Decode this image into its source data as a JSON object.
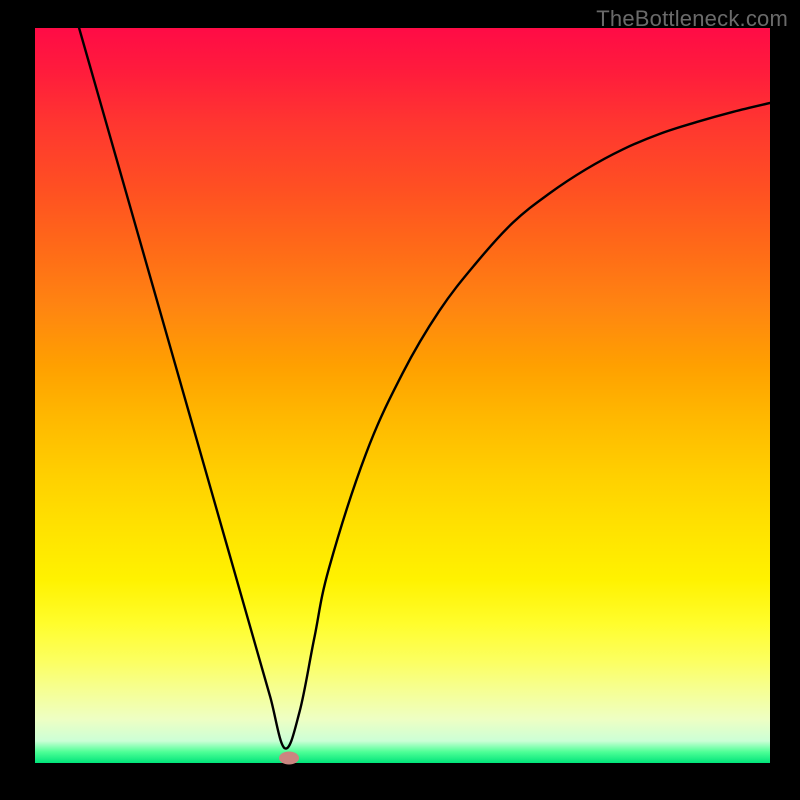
{
  "watermark": "TheBottleneck.com",
  "chart_data": {
    "type": "line",
    "title": "",
    "xlabel": "",
    "ylabel": "",
    "xlim": [
      0,
      100
    ],
    "ylim": [
      0,
      100
    ],
    "series": [
      {
        "name": "curve",
        "x": [
          6,
          8,
          10,
          12,
          14,
          16,
          18,
          20,
          22,
          24,
          26,
          28,
          30,
          32,
          34,
          36,
          38,
          40,
          45,
          50,
          55,
          60,
          65,
          70,
          75,
          80,
          85,
          90,
          95,
          100
        ],
        "y": [
          100,
          93.0,
          86.0,
          79.0,
          72.0,
          65.0,
          58.0,
          51.0,
          44.0,
          37.0,
          30.0,
          23.0,
          16.0,
          9.0,
          2.0,
          7.0,
          17.0,
          26.5,
          42.0,
          53.0,
          61.5,
          68.0,
          73.5,
          77.5,
          80.8,
          83.5,
          85.6,
          87.2,
          88.6,
          89.8
        ]
      }
    ],
    "marker": {
      "x": 34.5,
      "y": 0.7
    },
    "background_gradient": {
      "top": "#ff0b46",
      "mid": "#ffe200",
      "bottom": "#00e47a"
    }
  }
}
